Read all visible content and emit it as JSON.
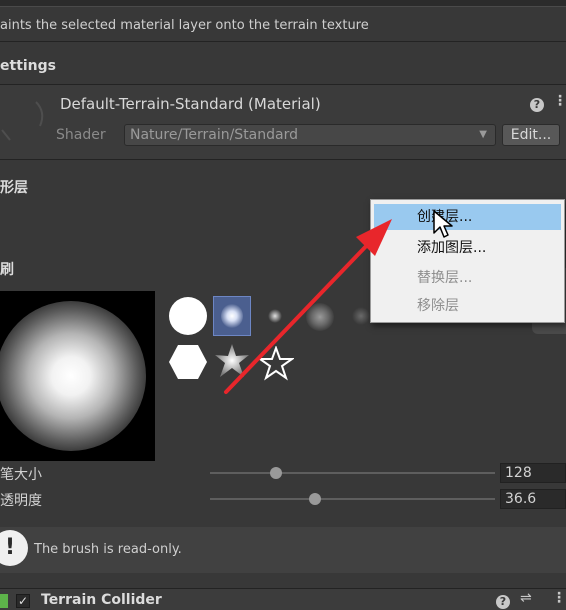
{
  "header": {
    "description": "aints the selected material layer onto the terrain texture"
  },
  "settings": {
    "title": "ettings",
    "material_name": "Default-Terrain-Standard (Material)",
    "shader_label": "Shader",
    "shader_value": "Nature/Terrain/Standard",
    "edit_button": "Edit..."
  },
  "layers": {
    "title": "形层"
  },
  "brushes": {
    "title": "刷",
    "items": [
      "circle",
      "soft-square",
      "small-dot",
      "cloud",
      "splatter",
      "hexagon",
      "spark",
      "star"
    ]
  },
  "context_menu": {
    "items": [
      {
        "label": "创建层...",
        "state": "selected"
      },
      {
        "label": "添加图层...",
        "state": "enabled"
      },
      {
        "label": "替换层...",
        "state": "disabled"
      },
      {
        "label": "移除层",
        "state": "disabled"
      }
    ]
  },
  "side_tab": {
    "glyph": "‹"
  },
  "properties": {
    "brush_size": {
      "label": "笔大小",
      "value": "128",
      "fraction": 0.23
    },
    "opacity": {
      "label": "透明度",
      "value": "36.6",
      "fraction": 0.37
    }
  },
  "info": {
    "message": "The brush is read-only."
  },
  "collider": {
    "title": "Terrain Collider"
  },
  "colors": {
    "background": "#383838",
    "menu_highlight": "#99c9ef",
    "arrow": "#e8262b"
  }
}
